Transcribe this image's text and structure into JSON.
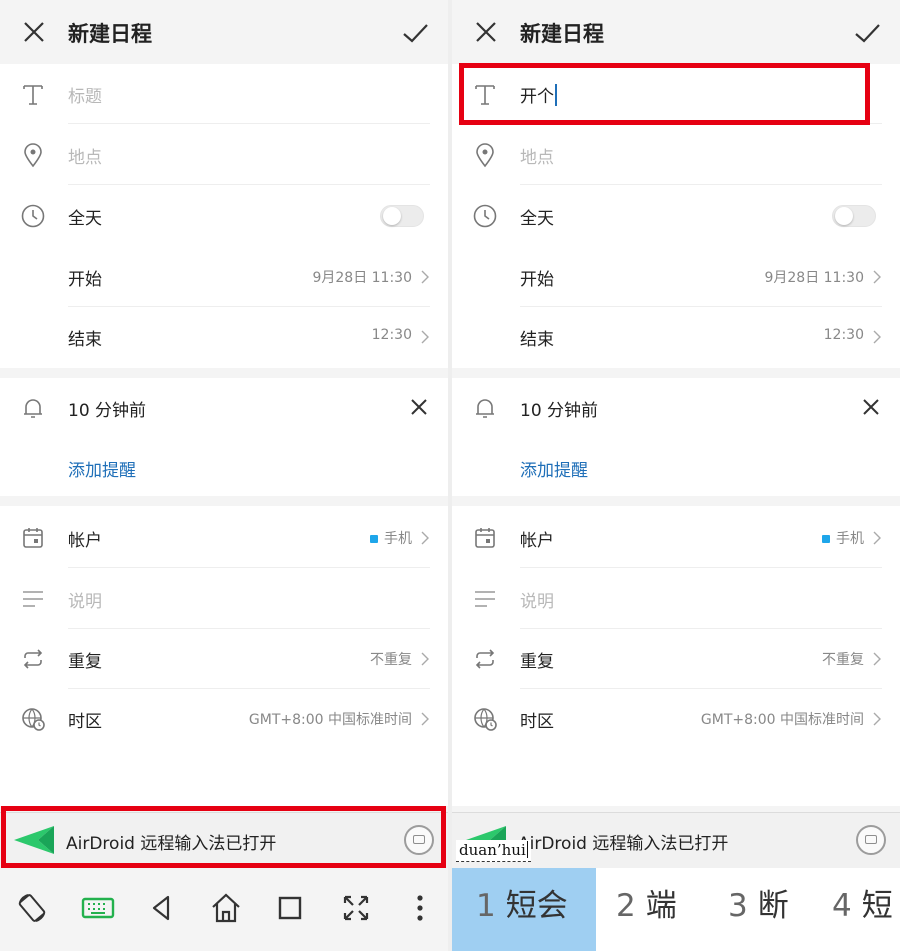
{
  "screen": {
    "title": "新建日程",
    "event": {
      "title_placeholder": "标题",
      "location_placeholder": "地点",
      "all_day_label": "全天",
      "all_day_on": false,
      "start_label": "开始",
      "start_value": "9月28日 11:30",
      "end_label": "结束",
      "end_value": "12:30"
    },
    "reminder": {
      "label": "10 分钟前",
      "add_label": "添加提醒"
    },
    "details": {
      "account_label": "帐户",
      "account_value": "手机",
      "account_color": "#1ea6ea",
      "description_placeholder": "说明",
      "repeat_label": "重复",
      "repeat_value": "不重复",
      "timezone_label": "时区",
      "timezone_value": "GMT+8:00 中国标准时间"
    },
    "airdroid_banner": "AirDroid 远程输入法已打开",
    "icons": {
      "close": "close-icon",
      "confirm": "check-icon",
      "title": "text-t-icon",
      "location": "location-pin-icon",
      "time": "clock-icon",
      "reminder": "bell-icon",
      "account": "calendar-icon",
      "description": "lines-icon",
      "repeat": "repeat-icon",
      "timezone": "globe-clock-icon"
    }
  },
  "left": {
    "navbar_icons": [
      "rotate-icon",
      "keyboard-icon",
      "back-icon",
      "home-icon",
      "recents-icon",
      "fullscreen-icon",
      "more-icon"
    ]
  },
  "right": {
    "title_value": "开个",
    "composing_text": "duan’hui",
    "candidates": [
      {
        "num": "1",
        "text": "短会",
        "selected": true
      },
      {
        "num": "2",
        "text": "端",
        "selected": false
      },
      {
        "num": "3",
        "text": "断",
        "selected": false
      },
      {
        "num": "4",
        "text": "短",
        "selected": false
      }
    ]
  },
  "colors": {
    "highlight": "#e60012",
    "link": "#1f6fb8",
    "airdroid_green": "#2cc86c",
    "candidate_selected": "#9fcff2"
  }
}
